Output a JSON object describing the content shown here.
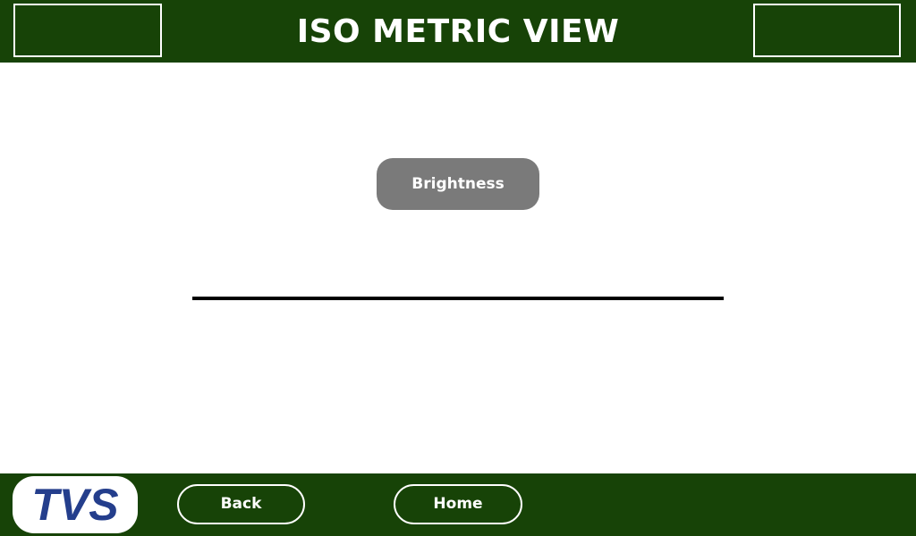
{
  "header": {
    "title": "ISO METRIC VIEW"
  },
  "main": {
    "brightness_label": "Brightness"
  },
  "footer": {
    "logo_text": "TVS",
    "back_label": "Back",
    "home_label": "Home"
  },
  "colors": {
    "bar": "#174307",
    "button_gray": "#7a7a7a",
    "logo_blue": "#243e8c"
  }
}
